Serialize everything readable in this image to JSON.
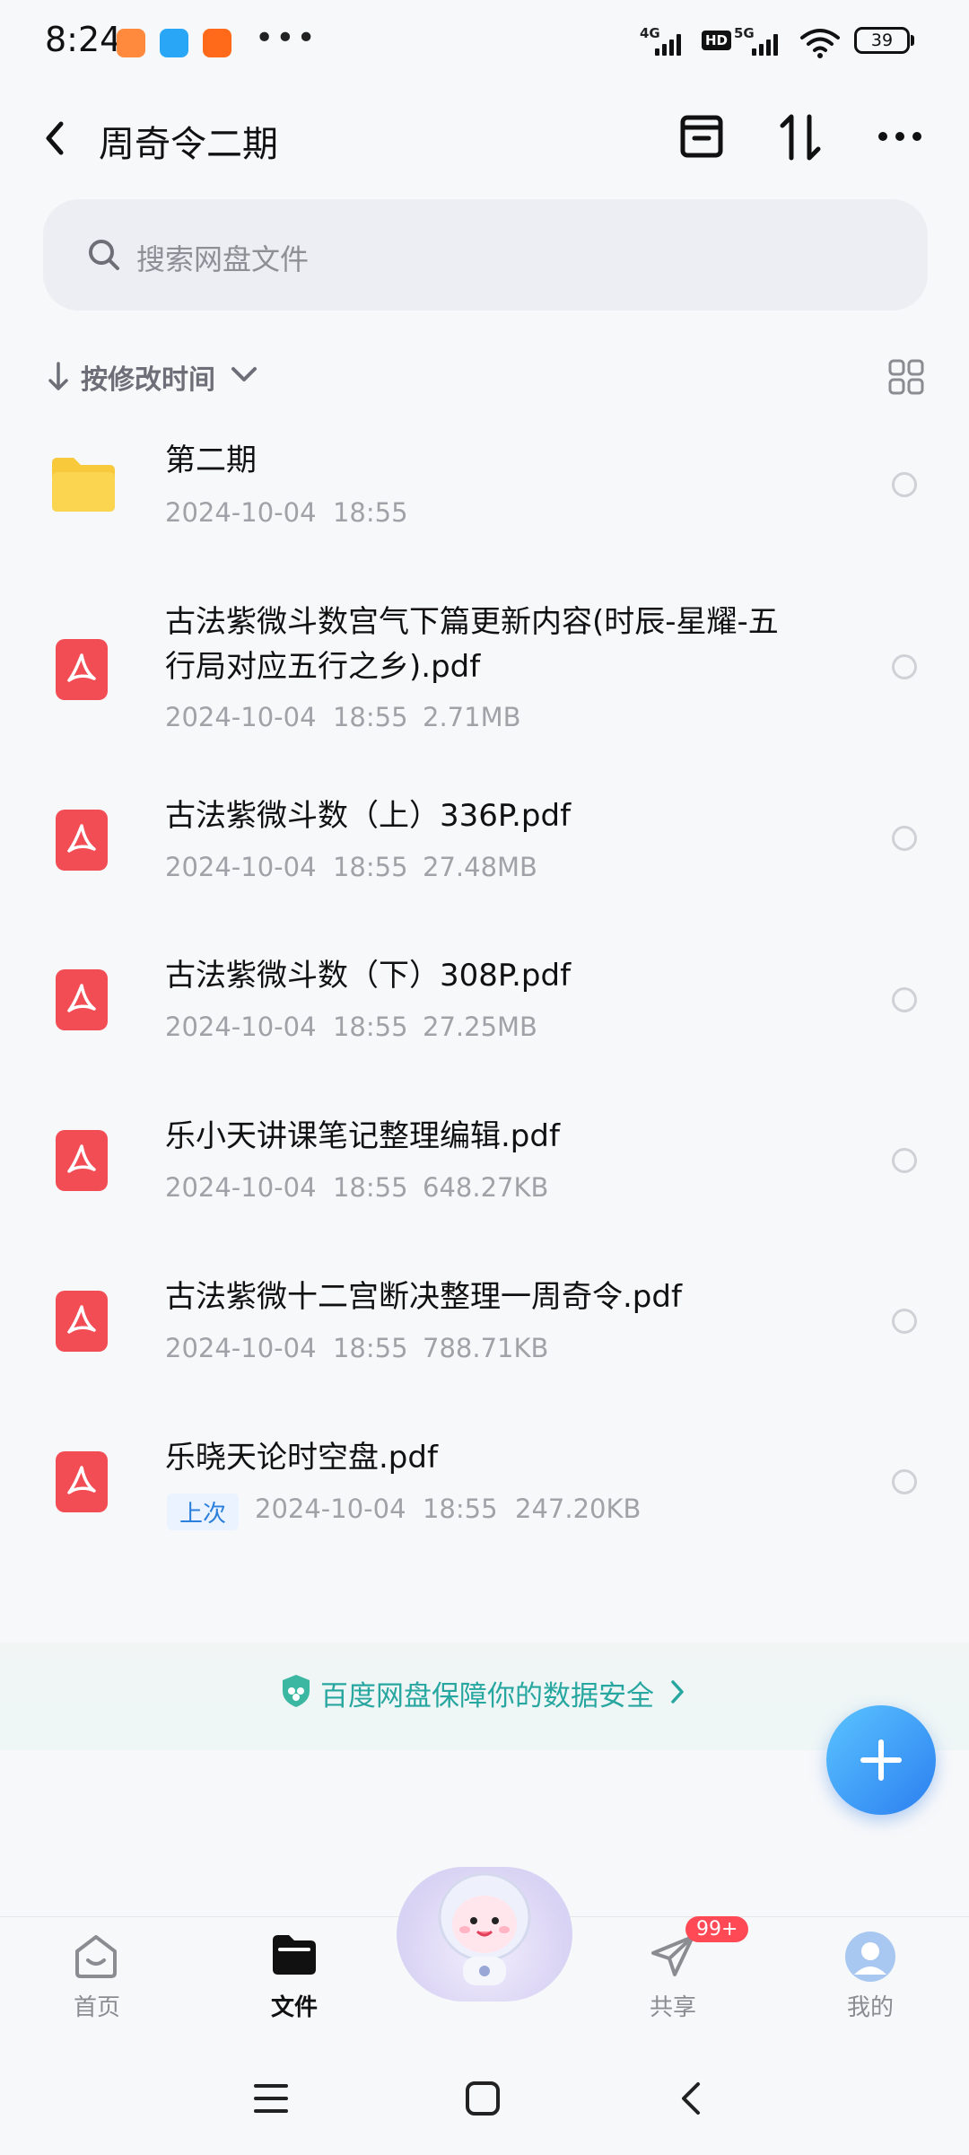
{
  "status_bar": {
    "time": "8:24",
    "network_1": "4G",
    "hd": "HD",
    "network_2": "5G",
    "battery": "39"
  },
  "header": {
    "title": "周奇令二期"
  },
  "search": {
    "placeholder": "搜索网盘文件"
  },
  "sort": {
    "label": "按修改时间"
  },
  "files": [
    {
      "name": "第二期",
      "date": "2024-10-04  18:55",
      "size": "",
      "type": "folder"
    },
    {
      "name_line1": "古法紫微斗数宫气下篇更新内容(时辰-星耀-五",
      "name_line2": "行局对应五行之乡).pdf",
      "date": "2024-10-04  18:55",
      "size": "2.71MB",
      "type": "pdf"
    },
    {
      "name": "古法紫微斗数（上）336P.pdf",
      "date": "2024-10-04  18:55",
      "size": "27.48MB",
      "type": "pdf"
    },
    {
      "name": "古法紫微斗数（下）308P.pdf",
      "date": "2024-10-04  18:55",
      "size": "27.25MB",
      "type": "pdf"
    },
    {
      "name": "乐小天讲课笔记整理编辑.pdf",
      "date": "2024-10-04  18:55",
      "size": "648.27KB",
      "type": "pdf"
    },
    {
      "name": "古法紫微十二宫断决整理一周奇令.pdf",
      "date": "2024-10-04  18:55",
      "size": "788.71KB",
      "type": "pdf"
    },
    {
      "name": "乐晓天论时空盘.pdf",
      "badge": "上次",
      "date": "2024-10-04  18:55",
      "size": "247.20KB",
      "type": "pdf"
    }
  ],
  "banner": {
    "text": "百度网盘保障你的数据安全"
  },
  "bottom_nav": {
    "home": "首页",
    "files": "文件",
    "share": "共享",
    "share_badge": "99+",
    "me": "我的"
  },
  "colors": {
    "pdf": "#f24c54",
    "folder": "#f8c93b",
    "accent": "#2b7ff0",
    "banner_text": "#28a6a0"
  }
}
